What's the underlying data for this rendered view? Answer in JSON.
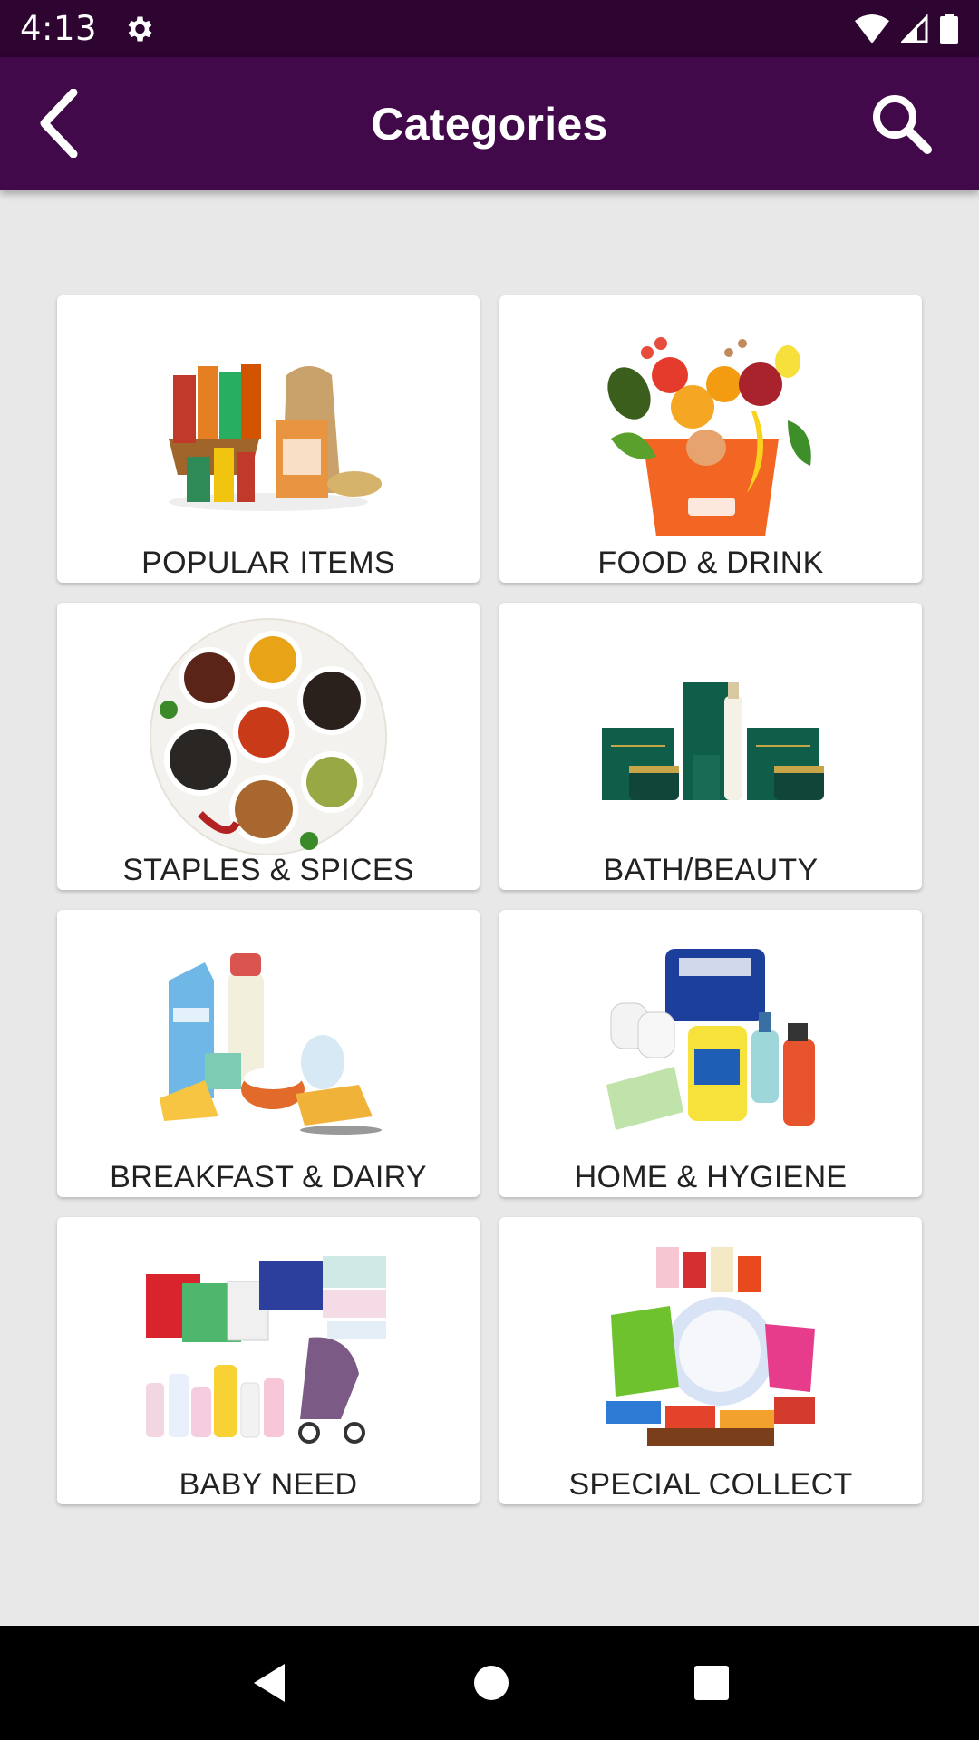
{
  "status_bar": {
    "time": "4:13",
    "icons": [
      "settings-gear-icon",
      "wifi-icon",
      "signal-icon",
      "battery-icon"
    ]
  },
  "app_bar": {
    "title": "Categories",
    "back_icon": "chevron-left-icon",
    "search_icon": "search-icon",
    "background": "#42094a",
    "status_background": "#2d0530"
  },
  "categories": [
    {
      "label": "POPULAR ITEMS",
      "image": "grocery-basket-image"
    },
    {
      "label": "FOOD & DRINK",
      "image": "fruits-vegetables-bag-image"
    },
    {
      "label": "STAPLES & SPICES",
      "image": "spice-plate-image"
    },
    {
      "label": "BATH/BEAUTY",
      "image": "beauty-products-image"
    },
    {
      "label": "BREAKFAST & DAIRY",
      "image": "dairy-products-image"
    },
    {
      "label": "HOME & HYGIENE",
      "image": "cleaning-products-image"
    },
    {
      "label": "BABY NEED",
      "image": "baby-products-image"
    },
    {
      "label": "SPECIAL COLLECT",
      "image": "snack-collection-image"
    }
  ],
  "nav_bar": {
    "icons": [
      "back-triangle-icon",
      "home-circle-icon",
      "recents-square-icon"
    ]
  }
}
